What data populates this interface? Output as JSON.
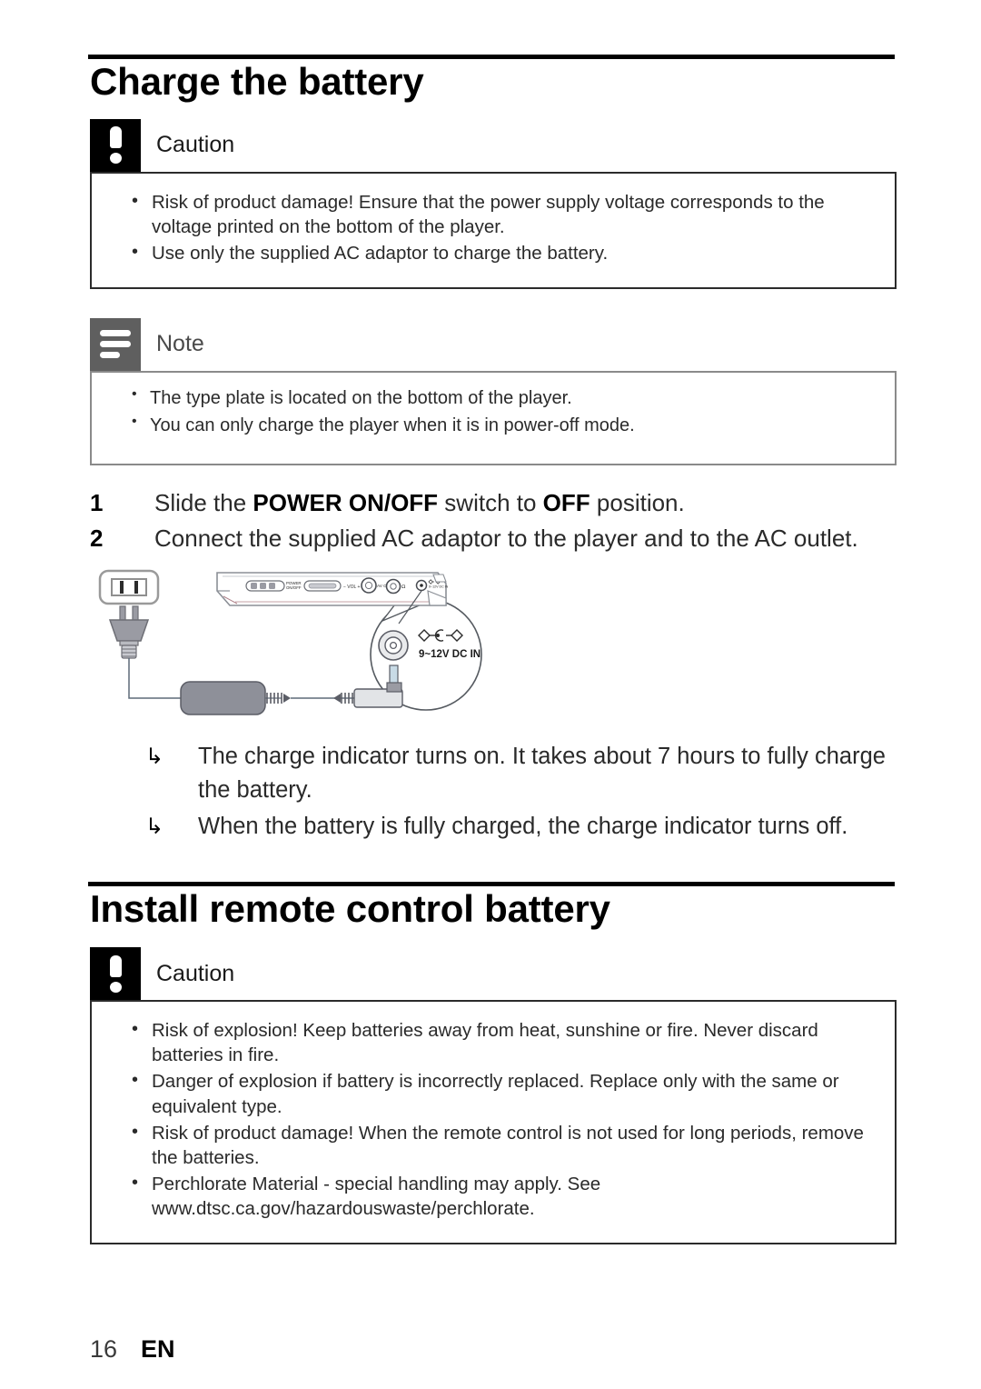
{
  "page": {
    "number": "16",
    "language": "EN"
  },
  "sections": [
    {
      "title": "Charge the battery",
      "caution": {
        "label": "Caution",
        "icon": "exclamation-icon",
        "items": [
          "Risk of product damage! Ensure that the power supply voltage corresponds to the voltage printed on the bottom of the player.",
          "Use only the supplied AC adaptor to charge the battery."
        ]
      },
      "note": {
        "label": "Note",
        "icon": "note-lines-icon",
        "items": [
          "The type plate is located on the bottom of the player.",
          "You can only charge the player when it is in power-off mode."
        ]
      },
      "steps": [
        {
          "number": "1",
          "parts": [
            {
              "text": "Slide the ",
              "bold": false
            },
            {
              "text": "POWER ON/OFF",
              "bold": true
            },
            {
              "text": " switch to ",
              "bold": false
            },
            {
              "text": "OFF",
              "bold": true
            },
            {
              "text": " position.",
              "bold": false
            }
          ]
        },
        {
          "number": "2",
          "parts": [
            {
              "text": "Connect the supplied AC adaptor to the player and to the AC outlet.",
              "bold": false
            }
          ]
        }
      ],
      "results": [
        "The charge indicator turns on. It takes about 7 hours to fully charge the battery.",
        "When the battery is fully charged, the charge indicator turns off."
      ],
      "figure": {
        "name": "ac-adaptor-connection-diagram",
        "labels": {
          "dc_in": "9~12V DC IN",
          "power_switch": "POWER ON/OFF",
          "volume": "− VOL +",
          "av_out": "AV OUT",
          "headphone": "Ω"
        }
      }
    },
    {
      "title": "Install remote control battery",
      "caution": {
        "label": "Caution",
        "icon": "exclamation-icon",
        "items": [
          "Risk of explosion! Keep batteries away from heat, sunshine or fire. Never discard batteries in fire.",
          "Danger of explosion if battery is incorrectly replaced. Replace only with the same or equivalent type.",
          "Risk of product damage! When the remote control is not used for long periods, remove the batteries.",
          "Perchlorate Material - special handling may apply. See www.dtsc.ca.gov/hazardouswaste/perchlorate."
        ]
      }
    }
  ]
}
